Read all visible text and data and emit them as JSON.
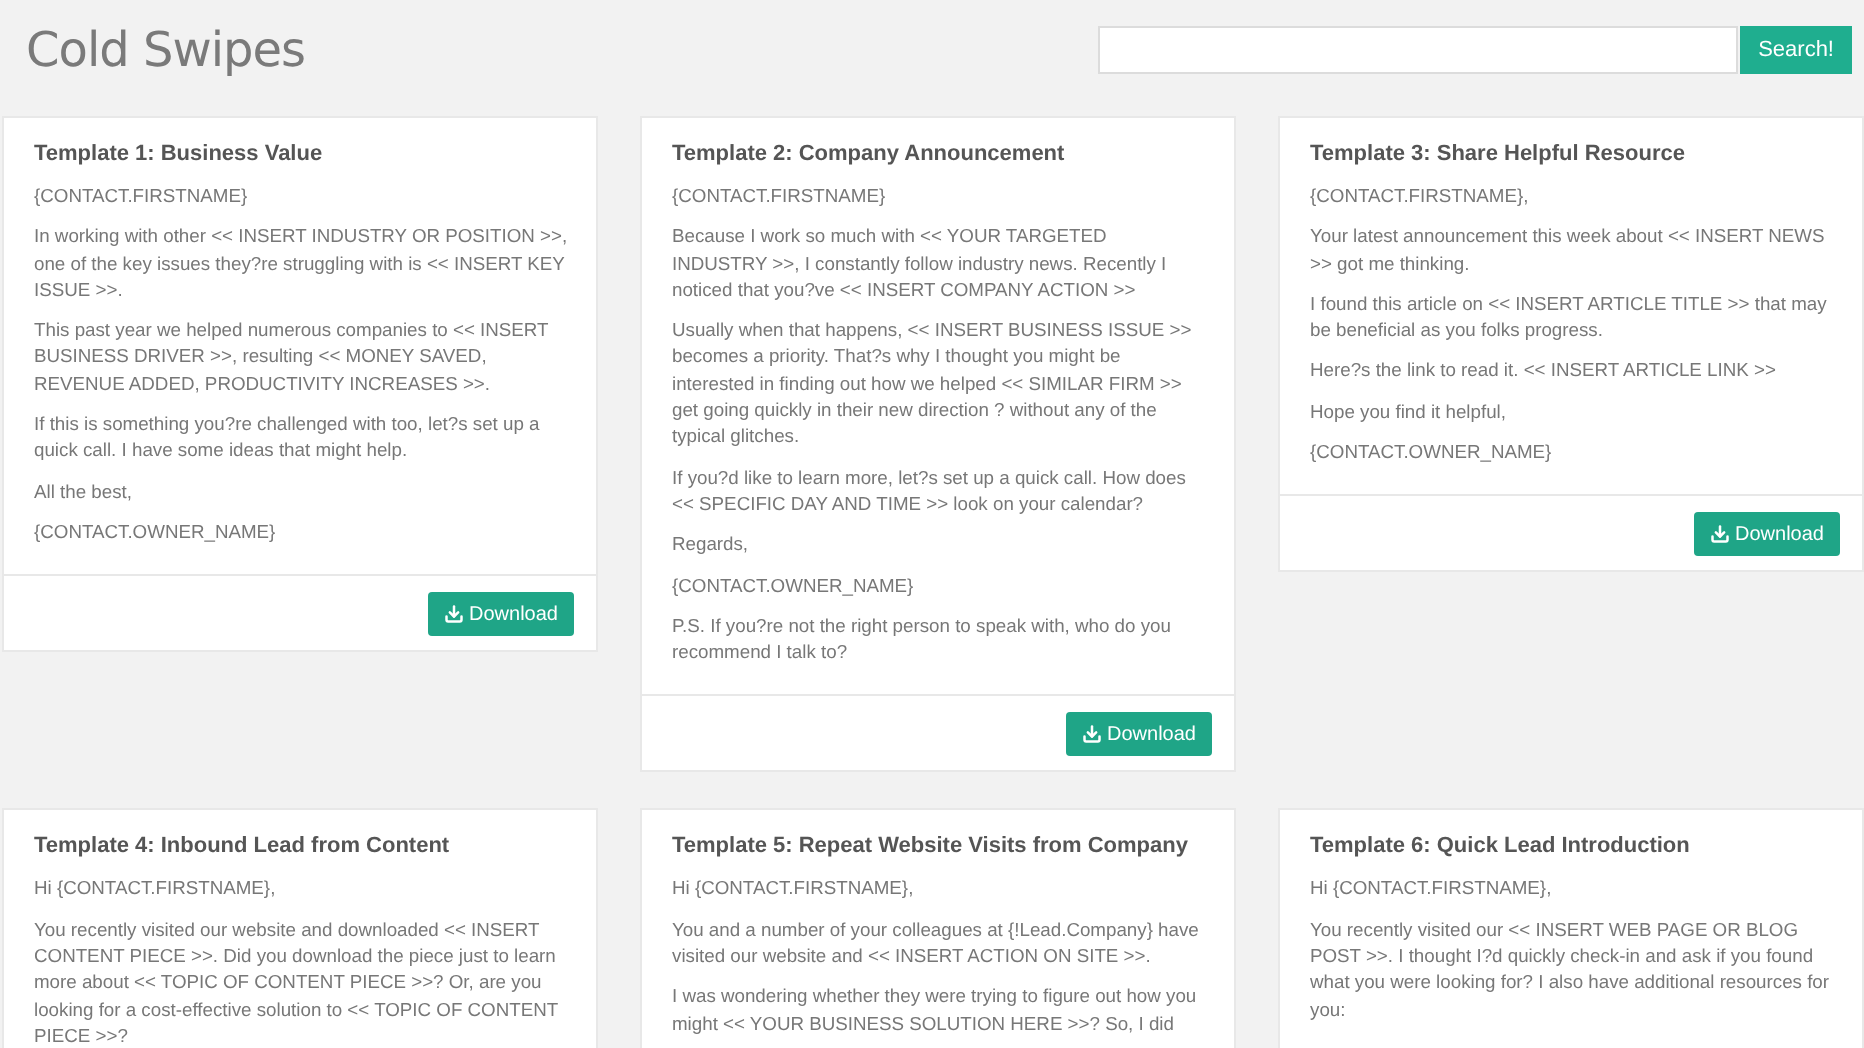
{
  "header": {
    "title": "Cold Swipes",
    "search": {
      "button": "Search!"
    }
  },
  "templates": [
    {
      "title": "Template 1: Business Value",
      "paragraphs": [
        "{CONTACT.FIRSTNAME}",
        "In working with other << INSERT INDUSTRY OR POSITION >>, one of the key issues they?re struggling with is << INSERT KEY ISSUE >>.",
        "This past year we helped numerous companies to << INSERT BUSINESS DRIVER >>, resulting << MONEY SAVED, REVENUE ADDED, PRODUCTIVITY INCREASES >>.",
        "If this is something you?re challenged with too, let?s set up a quick call. I have some ideas that might help.",
        "All the best,",
        "{CONTACT.OWNER_NAME}"
      ],
      "download": "Download"
    },
    {
      "title": "Template 2: Company Announcement",
      "paragraphs": [
        "{CONTACT.FIRSTNAME}",
        "Because I work so much with << YOUR TARGETED INDUSTRY >>, I constantly follow industry news. Recently I noticed that you?ve << INSERT COMPANY ACTION >>",
        "Usually when that happens, << INSERT BUSINESS ISSUE >> becomes a priority. That?s why I thought you might be interested in finding out how we helped << SIMILAR FIRM >> get going quickly in their new direction ? without any of the typical glitches.",
        "If you?d like to learn more, let?s set up a quick call. How does << SPECIFIC DAY AND TIME >> look on your calendar?",
        "Regards,",
        "{CONTACT.OWNER_NAME}",
        "P.S. If you?re not the right person to speak with, who do you recommend I talk to?"
      ],
      "download": "Download"
    },
    {
      "title": "Template 3: Share Helpful Resource",
      "paragraphs": [
        "{CONTACT.FIRSTNAME},",
        "Your latest announcement this week about << INSERT NEWS >> got me thinking.",
        "I found this article on << INSERT ARTICLE TITLE >> that may be beneficial as you folks progress.",
        "Here?s the link to read it. << INSERT ARTICLE LINK >>",
        "Hope you find it helpful,",
        "{CONTACT.OWNER_NAME}"
      ],
      "download": "Download"
    },
    {
      "title": "Template 4: Inbound Lead from Content",
      "paragraphs": [
        "Hi {CONTACT.FIRSTNAME},",
        "You recently visited our website and downloaded << INSERT CONTENT PIECE >>. Did you download the piece just to learn more about << TOPIC OF CONTENT PIECE >>? Or, are you looking for a cost-effective solution to << TOPIC OF CONTENT PIECE >>?"
      ]
    },
    {
      "title": "Template 5: Repeat Website Visits from Company",
      "paragraphs": [
        "Hi {CONTACT.FIRSTNAME},",
        "You and a number of your colleagues at {!Lead.Company} have visited our website and << INSERT ACTION ON SITE >>.",
        "I was wondering whether they were trying to figure out how you might << YOUR BUSINESS SOLUTION HERE >>? So, I did"
      ]
    },
    {
      "title": "Template 6: Quick Lead Introduction",
      "paragraphs": [
        "Hi {CONTACT.FIRSTNAME},",
        "You recently visited our << INSERT WEB PAGE OR BLOG POST >>. I thought I?d quickly check-in and ask if you found what you were looking for? I also have additional resources for you:"
      ]
    }
  ]
}
